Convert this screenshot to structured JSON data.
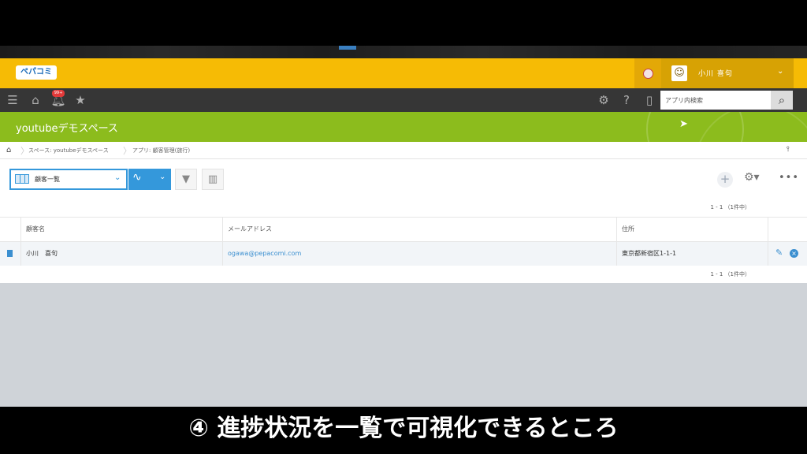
{
  "app": {
    "logo_text": "ペパコミ"
  },
  "user": {
    "name": "小川 喜句"
  },
  "nav": {
    "badge": "99+",
    "search_placeholder": "アプリ内検索"
  },
  "space": {
    "title": "youtubeデモスペース"
  },
  "breadcrumb": {
    "items": [
      "スペース: youtubeデモスペース",
      "アプリ: 顧客管理(旅行)"
    ]
  },
  "toolbar": {
    "view_label": "顧客一覧"
  },
  "pager": {
    "text": "1 - 1 （1件中）"
  },
  "table": {
    "columns": [
      "顧客名",
      "メールアドレス",
      "住所"
    ],
    "rows": [
      {
        "name": "小川　喜句",
        "email": "ogawa@pepacomi.com",
        "address": "東京都新宿区1-1-1"
      }
    ]
  },
  "caption": {
    "text": "④ 進捗状況を一覧で可視化できるところ"
  },
  "colors": {
    "brand": "#f6bb05",
    "space": "#8cbc1d",
    "accent": "#3498db",
    "nav": "#363636"
  }
}
